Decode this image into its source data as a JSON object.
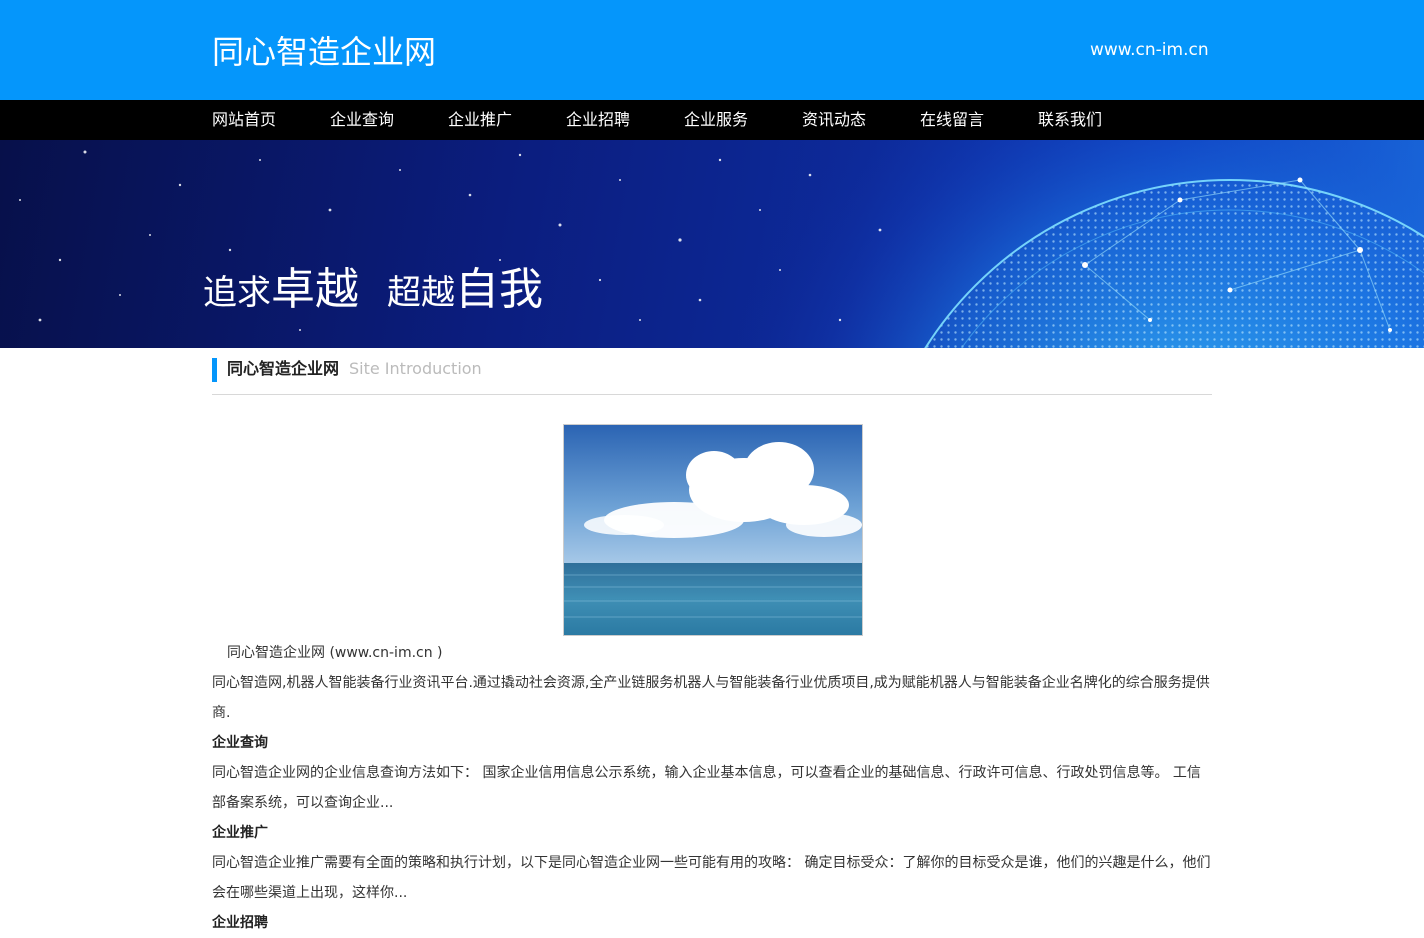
{
  "header": {
    "site_title": "同心智造企业网",
    "domain": "www.cn-im.cn"
  },
  "nav": {
    "items": [
      {
        "label": "网站首页"
      },
      {
        "label": "企业查询"
      },
      {
        "label": "企业推广"
      },
      {
        "label": "企业招聘"
      },
      {
        "label": "企业服务"
      },
      {
        "label": "资讯动态"
      },
      {
        "label": "在线留言"
      },
      {
        "label": "联系我们"
      }
    ]
  },
  "banner": {
    "slogan_part1_small": "追求",
    "slogan_part1_big": "卓越",
    "slogan_part2_small": "超越",
    "slogan_part2_big": "自我"
  },
  "section": {
    "title": "同心智造企业网",
    "subtitle": "Site Introduction",
    "caption": "同心智造企业网 (www.cn-im.cn )",
    "intro": "同心智造网,机器人智能装备行业资讯平台.通过撬动社会资源,全产业链服务机器人与智能装备行业优质项目,成为赋能机器人与智能装备企业名牌化的综合服务提供商.",
    "blocks": [
      {
        "heading": "企业查询",
        "text": "同心智造企业网的企业信息查询方法如下： 国家企业信用信息公示系统，输入企业基本信息，可以查看企业的基础信息、行政许可信息、行政处罚信息等。 工信部备案系统，可以查询企业..."
      },
      {
        "heading": "企业推广",
        "text": "同心智造企业推广需要有全面的策略和执行计划，以下是同心智造企业网一些可能有用的攻略： 确定目标受众：了解你的目标受众是谁，他们的兴趣是什么，他们会在哪些渠道上出现，这样你..."
      },
      {
        "heading": "企业招聘",
        "text": ""
      }
    ]
  },
  "colors": {
    "brand_blue": "#0596fb",
    "nav_bg": "#000000"
  }
}
